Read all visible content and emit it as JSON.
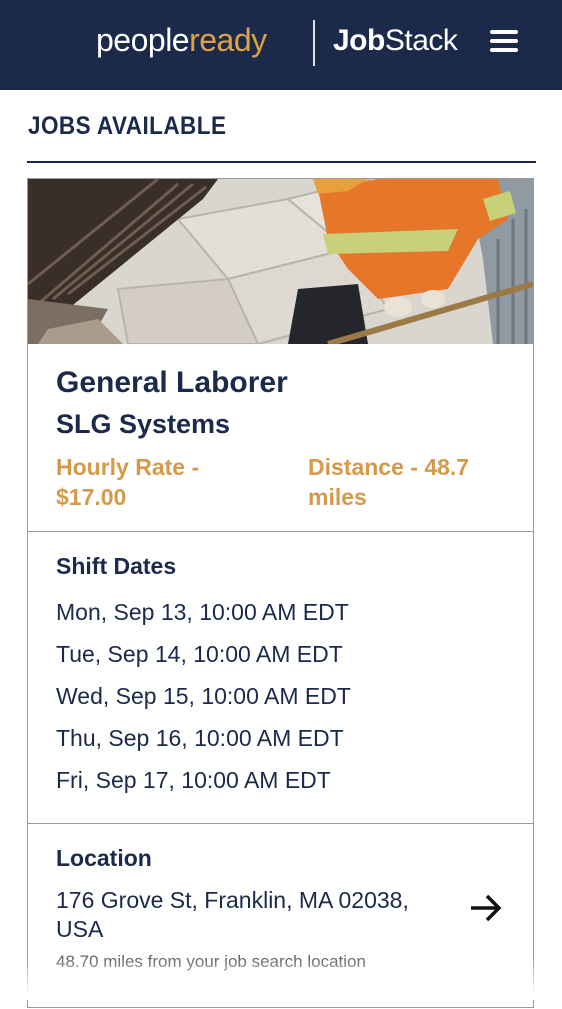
{
  "header": {
    "logo_people": "people",
    "logo_ready": "ready",
    "logo_jobstack_a": "Job",
    "logo_jobstack_b": "Stack",
    "menu_icon": "hamburger-menu-icon"
  },
  "page": {
    "section_title": "JOBS AVAILABLE"
  },
  "job": {
    "title": "General Laborer",
    "company": "SLG Systems",
    "rate": "Hourly Rate - $17.00",
    "distance": "Distance - 48.7 miles",
    "accent_color": "#d59a49"
  },
  "shifts": {
    "title": "Shift Dates",
    "items": [
      "Mon, Sep 13, 10:00 AM EDT",
      "Tue, Sep 14, 10:00 AM EDT",
      "Wed, Sep 15, 10:00 AM EDT",
      "Thu, Sep 16, 10:00 AM EDT",
      "Fri, Sep 17, 10:00 AM EDT"
    ]
  },
  "location": {
    "title": "Location",
    "address": "176 Grove St, Franklin, MA 02038, USA",
    "distance_note": "48.70 miles from your job search location",
    "arrow_icon": "arrow-right-icon"
  },
  "colors": {
    "navy": "#1b2a4a",
    "brand_orange": "#e0a143"
  }
}
